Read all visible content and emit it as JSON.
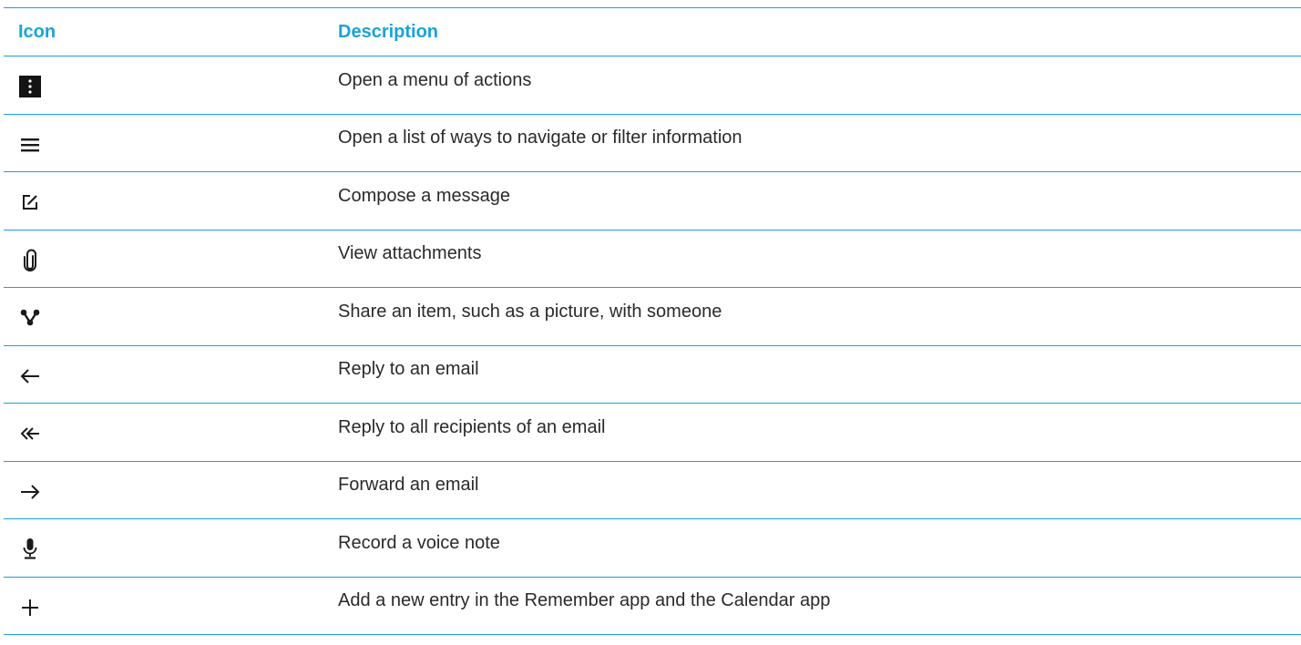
{
  "table": {
    "header_icon": "Icon",
    "header_description": "Description",
    "rows": [
      {
        "icon": "more-vertical-icon",
        "description": "Open a menu of actions"
      },
      {
        "icon": "hamburger-menu-icon",
        "description": "Open a list of ways to navigate or filter information"
      },
      {
        "icon": "compose-icon",
        "description": "Compose a message"
      },
      {
        "icon": "paperclip-icon",
        "description": "View attachments"
      },
      {
        "icon": "share-icon",
        "description": "Share an item, such as a picture, with someone"
      },
      {
        "icon": "reply-arrow-icon",
        "description": "Reply to an email"
      },
      {
        "icon": "reply-all-icon",
        "description": "Reply to all recipients of an email"
      },
      {
        "icon": "forward-arrow-icon",
        "description": "Forward an email"
      },
      {
        "icon": "microphone-icon",
        "description": "Record a voice note"
      },
      {
        "icon": "plus-icon",
        "description": "Add a new entry in the Remember app and the Calendar app"
      }
    ]
  },
  "colors": {
    "accent": "#1aa3d9",
    "text": "#2a2a2a",
    "icon": "#1a1a1a"
  }
}
